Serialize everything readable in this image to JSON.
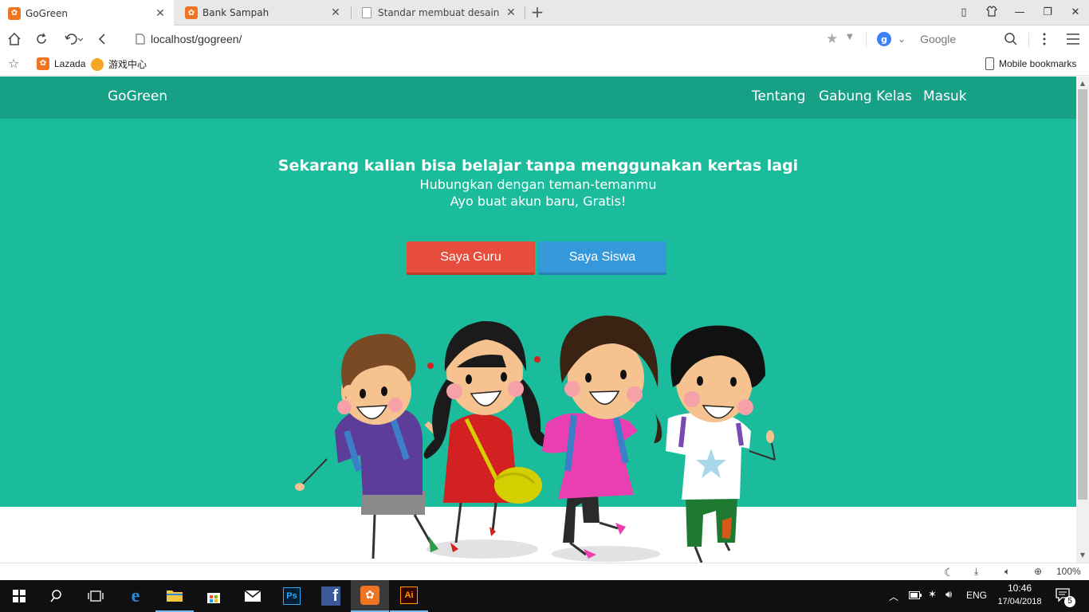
{
  "browser": {
    "tabs": [
      {
        "title": "GoGreen",
        "active": true
      },
      {
        "title": "Bank Sampah",
        "active": false
      },
      {
        "title": "Standar membuat desain web",
        "active": false
      }
    ],
    "url": "localhost/gogreen/",
    "search_engine": "Google",
    "bookmarks": [
      {
        "label": "Lazada"
      },
      {
        "label": "游戏中心"
      }
    ],
    "mobile_bookmarks": "Mobile bookmarks",
    "zoom": "100%"
  },
  "site": {
    "brand": "GoGreen",
    "menu": [
      "Tentang",
      "Gabung Kelas",
      "Masuk"
    ],
    "hero": {
      "title": "Sekarang kalian bisa belajar tanpa menggunakan kertas lagi",
      "subtitle1": "Hubungkan dengan teman-temanmu",
      "subtitle2": "Ayo buat akun baru, Gratis!",
      "btn_guru": "Saya Guru",
      "btn_siswa": "Saya Siswa"
    },
    "colors": {
      "nav": "#16a085",
      "hero": "#1abc9c",
      "btn_guru": "#e74c3c",
      "btn_siswa": "#3498db"
    }
  },
  "taskbar": {
    "language": "ENG",
    "time": "10:46",
    "date": "17/04/2018",
    "notifications": "5",
    "apps": [
      "start-icon",
      "search-icon",
      "task-view-icon",
      "edge-icon",
      "file-explorer-icon",
      "store-icon",
      "mail-icon",
      "photoshop-icon",
      "facebook-icon",
      "uc-browser-icon",
      "illustrator-icon"
    ]
  }
}
